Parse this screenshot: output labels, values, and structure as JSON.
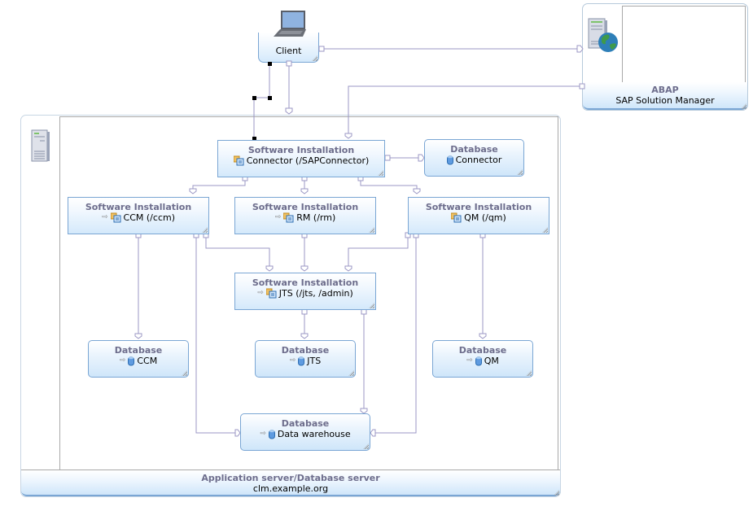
{
  "diagram": {
    "client": {
      "label": "Client",
      "icon": "laptop-icon"
    },
    "abap": {
      "title": "ABAP",
      "subtitle": "SAP Solution Manager",
      "icon": "web-server-icon"
    },
    "app_server": {
      "title": "Application server/Database server",
      "subtitle": "clm.example.org",
      "icon": "server-icon"
    },
    "software_installations": [
      {
        "id": "connector",
        "title": "Software Installation",
        "name": "Connector (/SAPConnector)"
      },
      {
        "id": "ccm",
        "title": "Software Installation",
        "name": "CCM (/ccm)"
      },
      {
        "id": "rm",
        "title": "Software Installation",
        "name": "RM (/rm)"
      },
      {
        "id": "qm",
        "title": "Software Installation",
        "name": "QM (/qm)"
      },
      {
        "id": "jts",
        "title": "Software Installation",
        "name": "JTS (/jts, /admin)"
      }
    ],
    "databases": [
      {
        "id": "db-connector",
        "title": "Database",
        "name": "Connector"
      },
      {
        "id": "db-ccm",
        "title": "Database",
        "name": "CCM"
      },
      {
        "id": "db-jts",
        "title": "Database",
        "name": "JTS"
      },
      {
        "id": "db-qm",
        "title": "Database",
        "name": "QM"
      },
      {
        "id": "db-dw",
        "title": "Database",
        "name": "Data warehouse"
      }
    ],
    "colors": {
      "connector_line": "#9b97c4",
      "node_border": "#7aa6d4",
      "title_text": "#6d6d8c",
      "selection_handle": "#000000"
    }
  }
}
